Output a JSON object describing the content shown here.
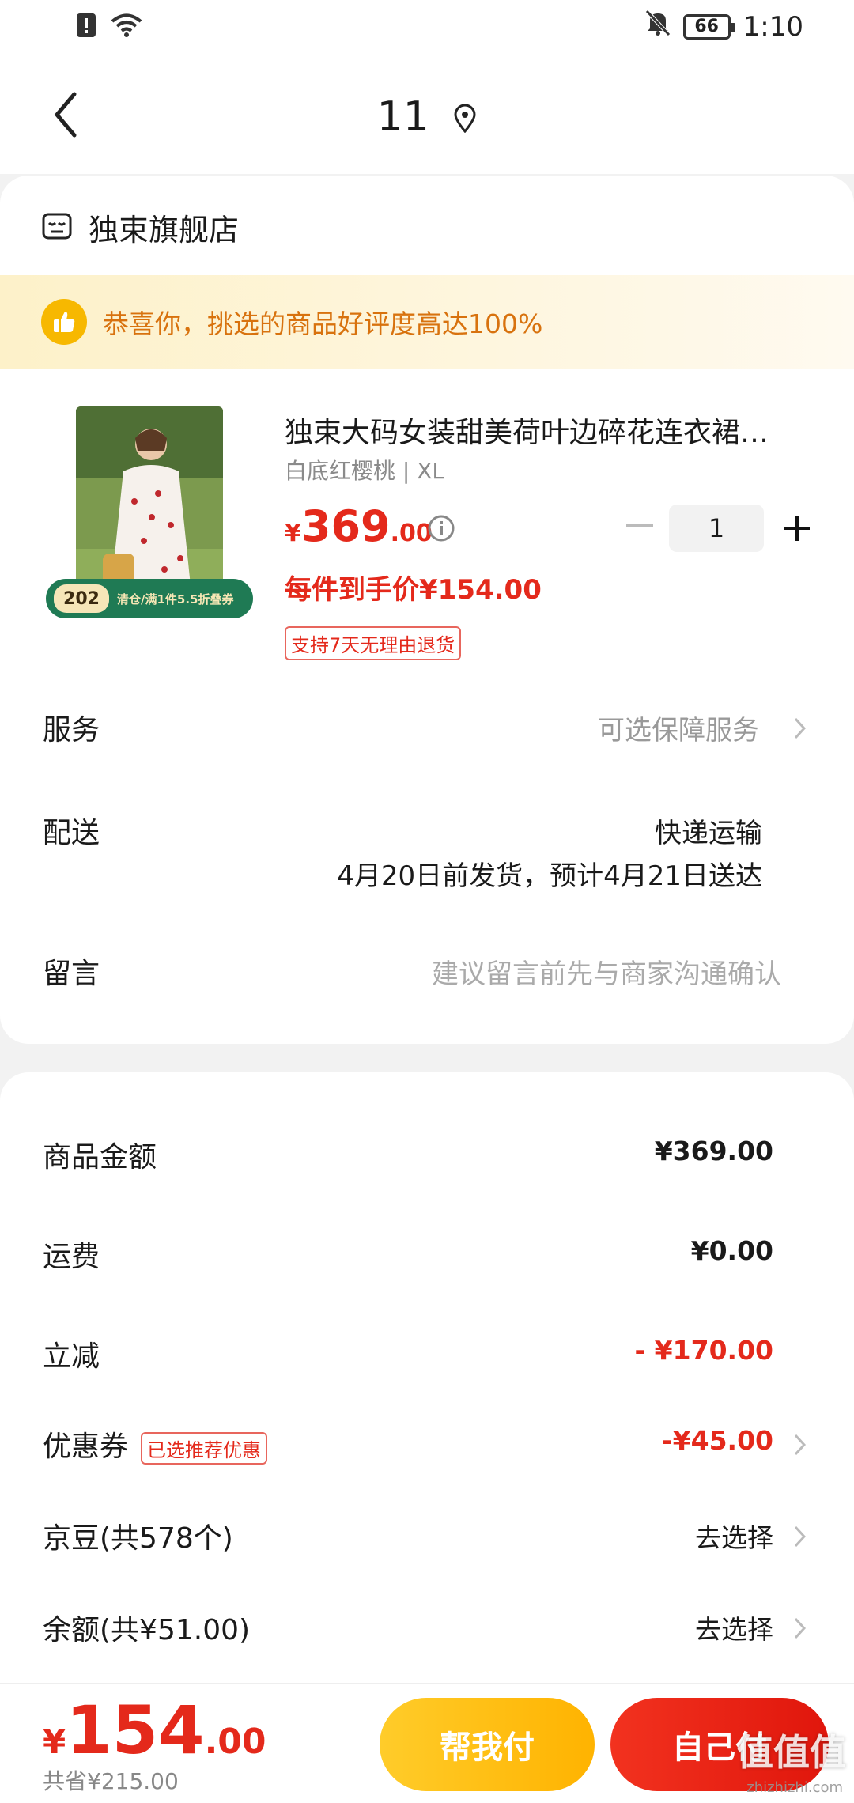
{
  "status_bar": {
    "time": "1:10",
    "battery": "66"
  },
  "nav": {
    "title": "11"
  },
  "shop": {
    "name": "独束旗舰店"
  },
  "praise": {
    "text": "恭喜你，挑选的商品好评度高达100%"
  },
  "product": {
    "title": "独束大码女装甜美荷叶边碎花连衣裙…",
    "spec": "白底红樱桃 | XL",
    "price_symbol": "¥",
    "price_int": "369",
    "price_dec": ".00",
    "quantity": "1",
    "unit_price": "每件到手价¥154.00",
    "return_policy": "支持7天无理由退货",
    "coupon_badge_num": "202",
    "coupon_badge_text": "清仓/满1件5.5折叠券"
  },
  "service": {
    "label": "服务",
    "value": "可选保障服务"
  },
  "delivery": {
    "label": "配送",
    "method": "快递运输",
    "eta": "4月20日前发货，预计4月21日送达"
  },
  "message": {
    "label": "留言",
    "placeholder": "建议留言前先与商家沟通确认"
  },
  "summary": {
    "goods_amount_label": "商品金额",
    "goods_amount": "¥369.00",
    "shipping_label": "运费",
    "shipping": "¥0.00",
    "discount_label": "立减",
    "discount": "- ¥170.00",
    "coupon_label": "优惠券",
    "coupon_tag": "已选推荐优惠",
    "coupon": "-¥45.00",
    "jd_beans_label": "京豆(共578个)",
    "jd_beans_action": "去选择",
    "balance_label": "余额(共¥51.00)",
    "balance_action": "去选择"
  },
  "bottom": {
    "total_symbol": "¥",
    "total_int": "154",
    "total_dec": ".00",
    "saved": "共省¥215.00",
    "help_pay": "帮我付",
    "self_pay": "自己付"
  },
  "watermark": {
    "text": "值值值",
    "sub": "zhizhizhi.com"
  },
  "colors": {
    "accent_red": "#e4291b",
    "accent_yellow": "#ffb300",
    "praise_orange": "#d8720e"
  }
}
